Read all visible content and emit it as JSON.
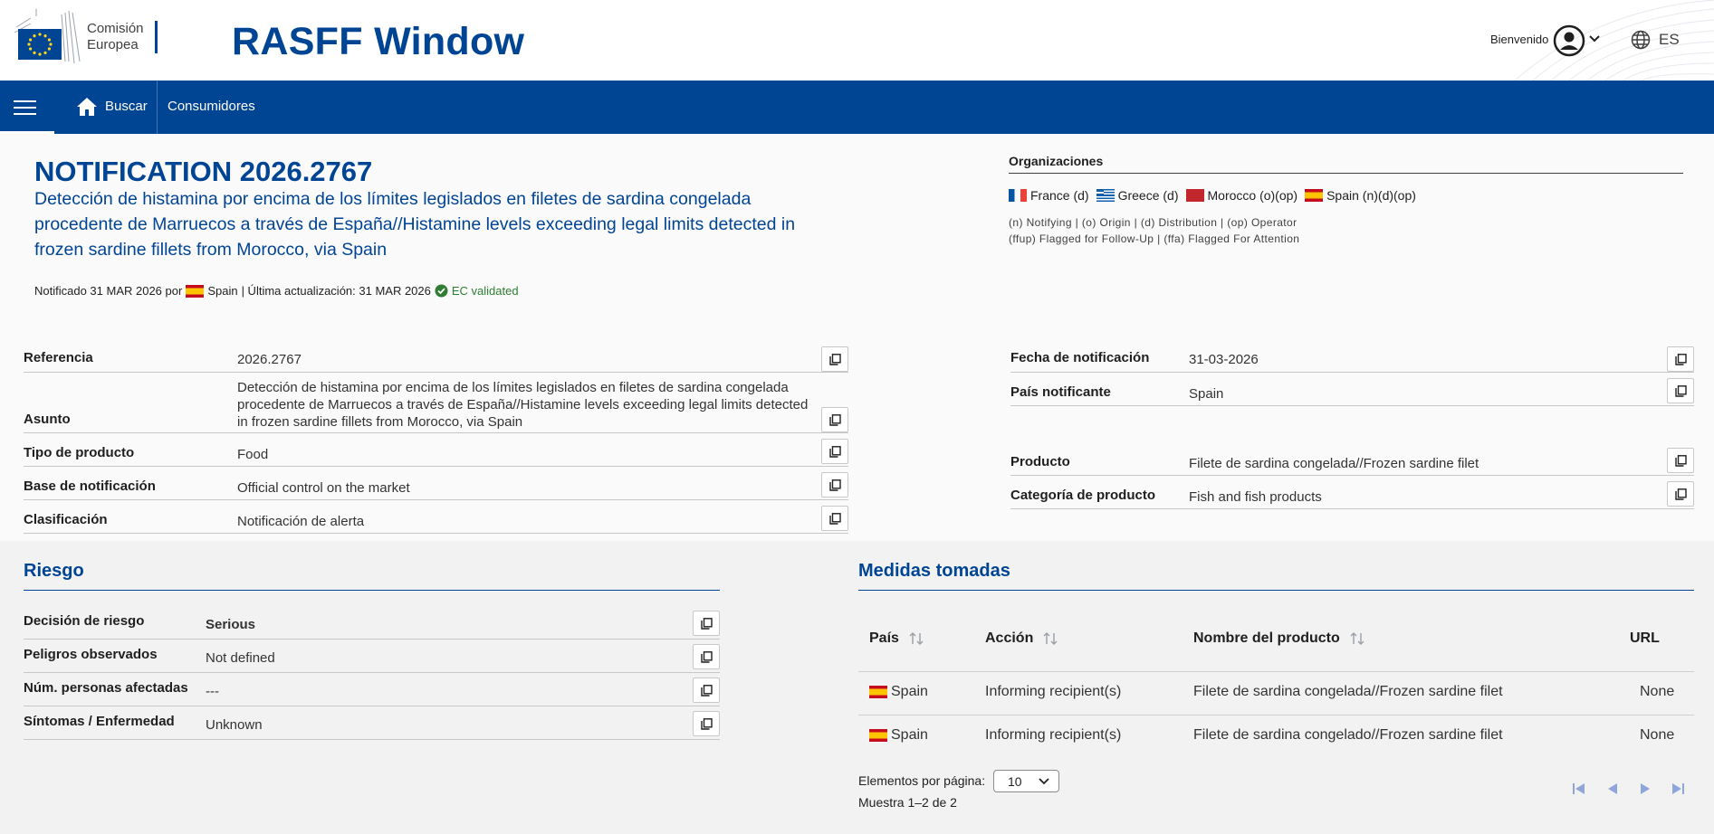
{
  "header": {
    "logo_line1": "Comisión",
    "logo_line2": "Europea",
    "app_title": "RASFF Window",
    "welcome": "Bienvenido",
    "language": "ES"
  },
  "nav": {
    "buscar": "Buscar",
    "consumidores": "Consumidores"
  },
  "notification": {
    "title": "NOTIFICATION 2026.2767",
    "subject": "Detección de histamina por encima de los límites legislados en filetes de sardina congelada procedente de Marruecos a través de España//Histamine levels exceeding legal limits detected in frozen sardine fillets from Morocco, via Spain",
    "notified_prefix": "Notificado 31 MAR 2026 por",
    "notified_country": "Spain",
    "updated": "| Última actualización: 31 MAR 2026",
    "validated": "EC validated"
  },
  "organizations": {
    "heading": "Organizaciones",
    "items": [
      {
        "country": "France (d)",
        "flag": "fr"
      },
      {
        "country": "Greece (d)",
        "flag": "gr"
      },
      {
        "country": "Morocco (o)(op)",
        "flag": "ma"
      },
      {
        "country": "Spain (n)(d)(op)",
        "flag": "es"
      }
    ],
    "legend_line1": "(n) Notifying | (o) Origin | (d) Distribution | (op) Operator",
    "legend_line2": "(ffup) Flagged for Follow-Up | (ffa) Flagged For Attention"
  },
  "details_left": [
    {
      "label": "Referencia",
      "value": "2026.2767"
    },
    {
      "label": "Asunto",
      "value": "Detección de histamina por encima de los límites legislados en filetes de sardina congelada procedente de Marruecos a través de España//Histamine levels exceeding legal limits detected in frozen sardine fillets from Morocco, via Spain"
    },
    {
      "label": "Tipo de producto",
      "value": "Food"
    },
    {
      "label": "Base de notificación",
      "value": "Official control on the market"
    },
    {
      "label": "Clasificación",
      "value": "Notificación de alerta"
    }
  ],
  "details_right": [
    {
      "label": "Fecha de notificación",
      "value": "31-03-2026"
    },
    {
      "label": "País notificante",
      "value": "Spain"
    },
    {
      "label": "Producto",
      "value": "Filete de sardina congelada//Frozen sardine filet"
    },
    {
      "label": "Categoría de producto",
      "value": "Fish and fish products"
    }
  ],
  "risk": {
    "heading": "Riesgo",
    "rows": [
      {
        "label": "Decisión de riesgo",
        "value": "Serious"
      },
      {
        "label": "Peligros observados",
        "value": "Not defined"
      },
      {
        "label": "Núm. personas afectadas",
        "value": "---"
      },
      {
        "label": "Síntomas / Enfermedad",
        "value": "Unknown"
      }
    ]
  },
  "measures": {
    "heading": "Medidas tomadas",
    "columns": [
      "País",
      "Acción",
      "Nombre del producto",
      "URL"
    ],
    "rows": [
      {
        "country": "Spain",
        "action": "Informing recipient(s)",
        "product": "Filete de sardina congelada//Frozen sardine filet",
        "url": "None"
      },
      {
        "country": "Spain",
        "action": "Informing recipient(s)",
        "product": "Filete de sardina congelado//Frozen sardine filet",
        "url": "None"
      }
    ],
    "per_page_label": "Elementos por página:",
    "per_page_value": "10",
    "range": "Muestra 1–2 de 2"
  },
  "colors": {
    "brand": "#004494",
    "serious": "#c3102f",
    "validated": "#2e7d32"
  }
}
